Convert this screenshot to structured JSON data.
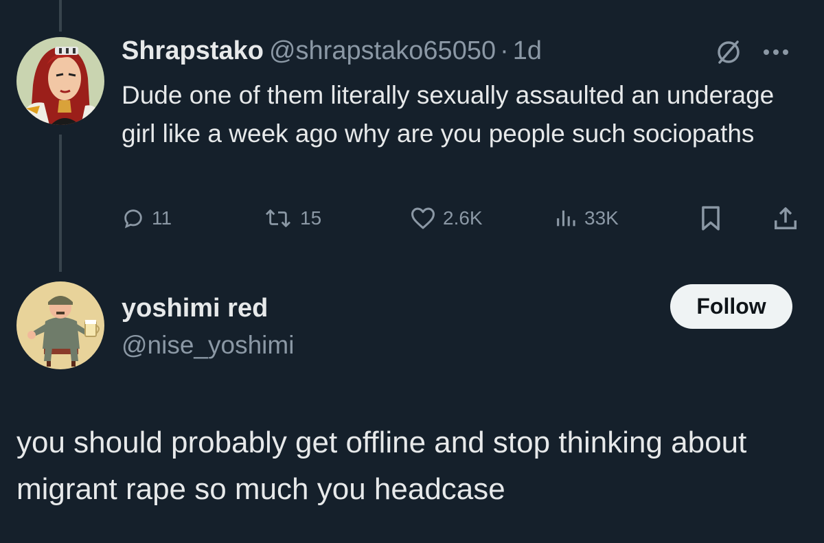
{
  "colors": {
    "background": "#15202b",
    "primary_text": "#e7e9ea",
    "secondary_text": "#8b98a5",
    "thread_line": "#38444d",
    "follow_button_bg": "#eff3f4"
  },
  "parent_tweet": {
    "display_name": "Shrapstako",
    "handle": "@shrapstako65050",
    "separator": "·",
    "timestamp": "1d",
    "text": "Dude one of them literally sexually assaulted an underage girl like a week ago why are you people such sociopaths",
    "avatar_icon": "avatar-red-haired-cartoon-woman",
    "header_icons": [
      "grok-icon",
      "more-options-icon"
    ],
    "actions": {
      "replies": "11",
      "reposts": "15",
      "likes": "2.6K",
      "views": "33K"
    },
    "action_icons": [
      "reply-icon",
      "repost-icon",
      "like-icon",
      "views-icon",
      "bookmark-icon",
      "share-icon"
    ]
  },
  "reply_tweet": {
    "display_name": "yoshimi red",
    "handle": "@nise_yoshimi",
    "follow_label": "Follow",
    "avatar_icon": "avatar-cartoon-man-with-beer",
    "text": "you should probably get offline and stop thinking about migrant rape so much you headcase"
  }
}
